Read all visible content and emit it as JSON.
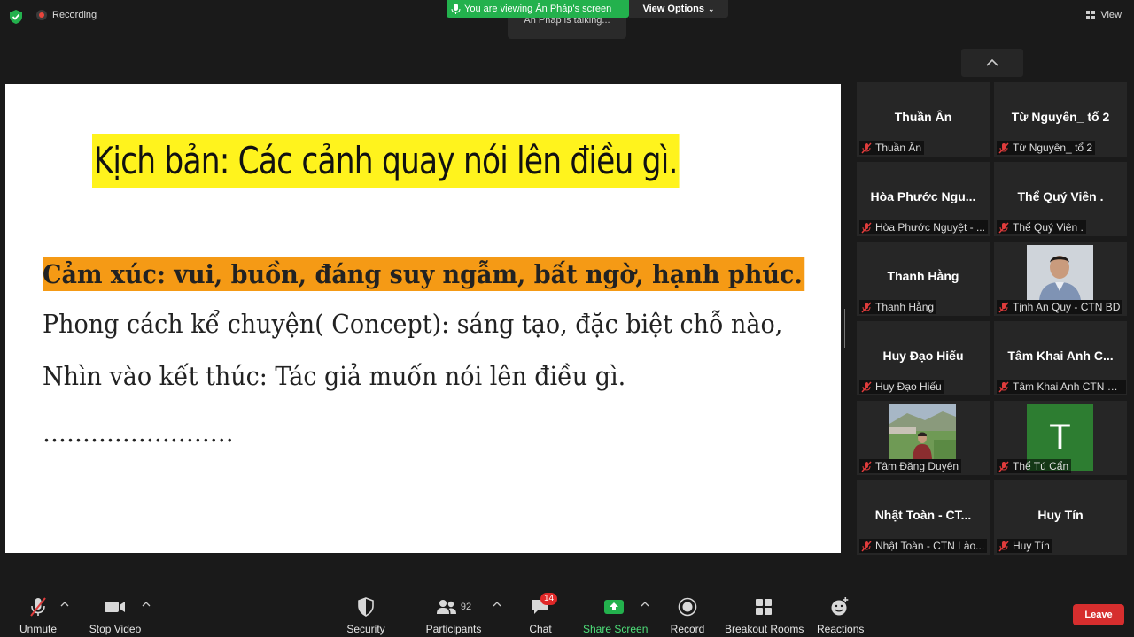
{
  "topbar": {
    "recording_label": "Recording",
    "viewing_label": "You are viewing Ân Pháp's screen",
    "view_options_label": "View Options",
    "talking_label": "Ân Pháp is talking...",
    "view_label": "View"
  },
  "slide": {
    "title": "Kịch bản: Các cảnh quay nói lên điều gì.",
    "line1": "Cảm xúc: vui, buồn, đáng suy ngẫm, bất ngờ, hạnh phúc.",
    "line2": "Phong cách kể chuyện( Concept): sáng tạo, đặc biệt chỗ nào,",
    "line3": "Nhìn vào kết thúc: Tác giả muốn nói lên điều gì.",
    "line4": "……………………"
  },
  "gallery": [
    {
      "name": "Thuần Ân",
      "label": "Thuần Ân"
    },
    {
      "name": "Từ Nguyên_ tổ 2",
      "label": "Từ Nguyên_ tổ 2"
    },
    {
      "name": "Hòa Phước Ngu...",
      "label": "Hòa Phước Nguyệt - ..."
    },
    {
      "name": "Thể Quý Viên .",
      "label": "Thể Quý Viên ."
    },
    {
      "name": "Thanh Hằng",
      "label": "Thanh Hằng"
    },
    {
      "name": "",
      "label": "Tịnh An Quy - CTN BD"
    },
    {
      "name": "Huy Đạo Hiếu",
      "label": "Huy Đạo Hiếu"
    },
    {
      "name": "Tâm Khai Anh C...",
      "label": "Tâm Khai Anh CTN Vĩ..."
    },
    {
      "name": "",
      "label": "Tâm Đăng Duyên"
    },
    {
      "name": "",
      "label": "Thể Tú Cẩn",
      "avatar": "T"
    },
    {
      "name": "Nhật Toàn - CT...",
      "label": "Nhật Toàn - CTN Lào..."
    },
    {
      "name": "Huy Tín",
      "label": "Huy Tín"
    }
  ],
  "toolbar": {
    "unmute": "Unmute",
    "stop_video": "Stop Video",
    "security": "Security",
    "participants": "Participants",
    "participants_count": "92",
    "chat": "Chat",
    "chat_badge": "14",
    "share_screen": "Share Screen",
    "record": "Record",
    "breakout_rooms": "Breakout Rooms",
    "reactions": "Reactions",
    "leave": "Leave"
  },
  "colors": {
    "share_green": "#23b14d",
    "leave_red": "#d62e2e",
    "title_highlight": "#fff31d",
    "line_highlight": "#f59a15"
  }
}
